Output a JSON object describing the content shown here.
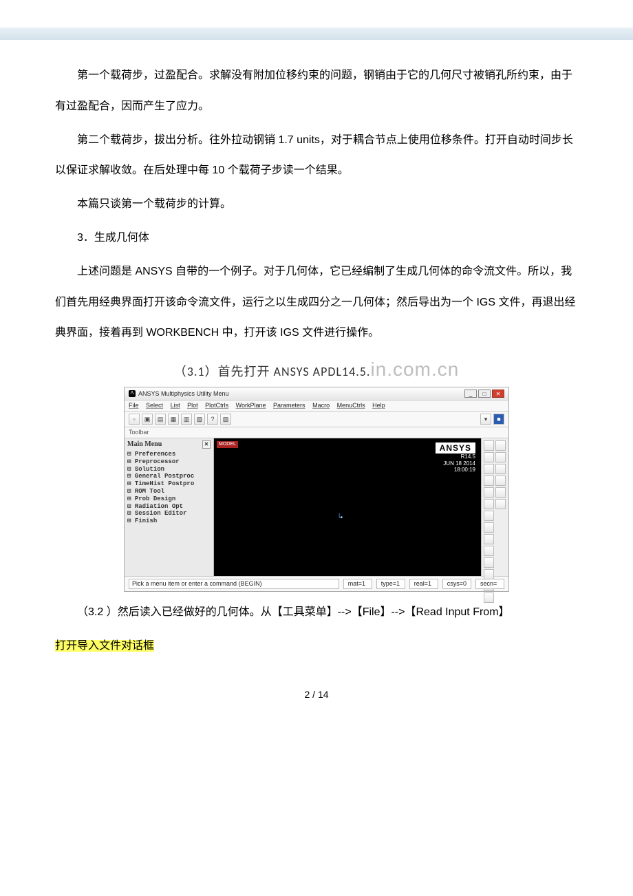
{
  "paragraphs": {
    "p1": "第一个载荷步，过盈配合。求解没有附加位移约束的问题，钢销由于它的几何尺寸被销孔所约束，由于有过盈配合，因而产生了应力。",
    "p2": "第二个载荷步，拔出分析。往外拉动钢销 1.7 units，对于耦合节点上使用位移条件。打开自动时间步长以保证求解收敛。在后处理中每 10 个载荷子步读一个结果。",
    "p3": "本篇只谈第一个载荷步的计算。",
    "p4": "3．生成几何体",
    "p5": "上述问题是 ANSYS 自带的一个例子。对于几何体，它已经编制了生成几何体的命令流文件。所以，我们首先用经典界面打开该命令流文件，运行之以生成四分之一几何体；然后导出为一个 IGS 文件，再退出经典界面，接着再到 WORKBENCH 中，打开该 IGS 文件进行操作。",
    "wm_prefix": "（3.1）首先打开 ANSYS APDL14.5.",
    "wm_suffix": "in.com.cn",
    "p7a": "（3.2 ）然后读入已经做好的几何体。从【工具菜单】-->【File】-->【Read Input From】",
    "p7b": "打开导入文件对话框"
  },
  "screenshot": {
    "title": "ANSYS Multiphysics Utility Menu",
    "menus": [
      "File",
      "Select",
      "List",
      "Plot",
      "PlotCtrls",
      "WorkPlane",
      "Parameters",
      "Macro",
      "MenuCtrls",
      "Help"
    ],
    "toolbar_label": "Toolbar",
    "tree_title": "Main Menu",
    "tree_items": [
      "⊞ Preferences",
      "⊞ Preprocessor",
      "⊞ Solution",
      "⊞ General Postproc",
      "⊞ TimeHist Postpro",
      "⊞ ROM Tool",
      "⊞ Prob Design",
      "⊞ Radiation Opt",
      "⊞ Session Editor",
      "⊞ Finish"
    ],
    "gfx_badge": "MODEL",
    "gfx_brand": "ANSYS",
    "gfx_version": "R14.5",
    "gfx_date": "JUN 18 2014",
    "gfx_time": "18:00:19",
    "status_prompt": "Pick a menu item or enter a command (BEGIN)",
    "status_fields": {
      "mat": "mat=1",
      "type": "type=1",
      "real": "real=1",
      "csys": "csys=0",
      "secn": "secn="
    }
  },
  "footer": "2  /  14"
}
